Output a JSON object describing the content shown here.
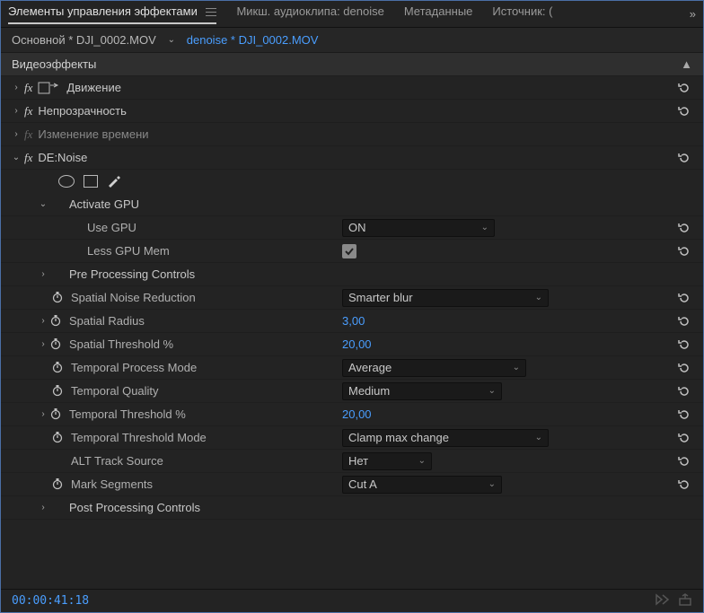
{
  "tabs": {
    "effect_controls": "Элементы управления эффектами",
    "audio_mixer": "Микш. аудиоклипа: denoise",
    "metadata": "Метаданные",
    "source": "Источник: ("
  },
  "crumbs": {
    "main": "Основной * DJI_0002.MOV",
    "seq": "denoise * DJI_0002.MOV"
  },
  "section": "Видеоэффекты",
  "effects": {
    "motion": "Движение",
    "opacity": "Непрозрачность",
    "time_remap": "Изменение времени",
    "denoise": "DE:Noise"
  },
  "groups": {
    "activate_gpu": "Activate GPU",
    "pre_processing": "Pre Processing Controls",
    "post_processing": "Post Processing Controls"
  },
  "params": {
    "use_gpu": {
      "label": "Use GPU",
      "value": "ON"
    },
    "less_gpu": {
      "label": "Less GPU Mem"
    },
    "spatial_nr": {
      "label": "Spatial Noise Reduction",
      "value": "Smarter blur"
    },
    "spatial_radius": {
      "label": "Spatial Radius",
      "value": "3,00"
    },
    "spatial_threshold": {
      "label": "Spatial Threshold %",
      "value": "20,00"
    },
    "temporal_mode": {
      "label": "Temporal Process Mode",
      "value": "Average"
    },
    "temporal_quality": {
      "label": "Temporal Quality",
      "value": "Medium"
    },
    "temporal_threshold": {
      "label": "Temporal Threshold %",
      "value": "20,00"
    },
    "temporal_threshold_mode": {
      "label": "Temporal Threshold Mode",
      "value": "Clamp max change"
    },
    "alt_track": {
      "label": "ALT Track Source",
      "value": "Нет"
    },
    "mark_segments": {
      "label": "Mark Segments",
      "value": "Cut A"
    }
  },
  "timecode": "00:00:41:18"
}
